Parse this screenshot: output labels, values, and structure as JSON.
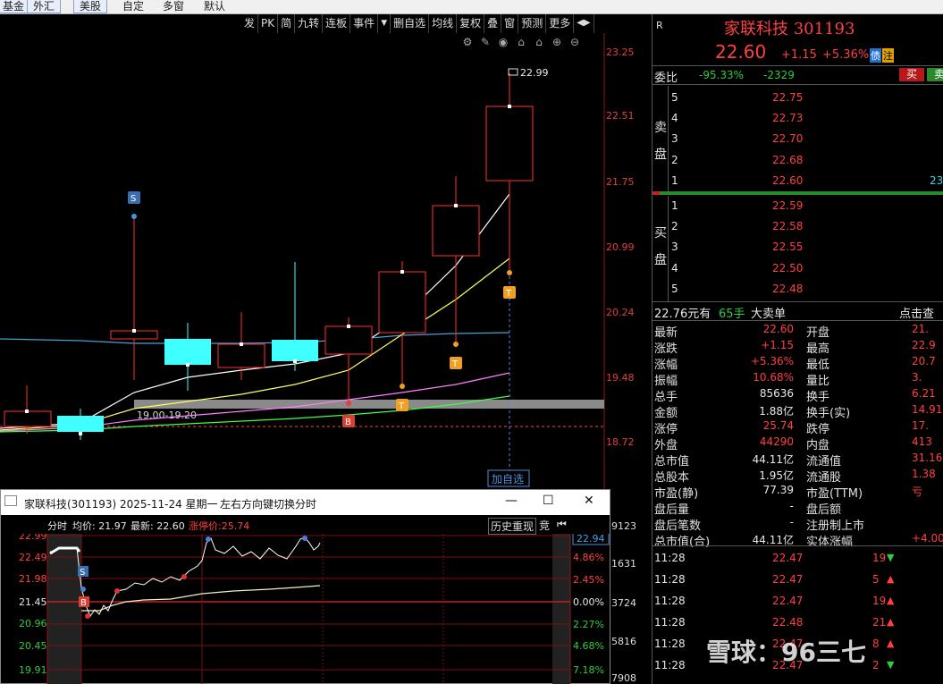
{
  "topbar": {
    "tabs": [
      "基金",
      "外汇",
      "美股",
      "自定",
      "多窗",
      "默认"
    ]
  },
  "chart_toolbar": {
    "items": [
      "发",
      "PK",
      "简",
      "九转",
      "连板",
      "事件",
      "▼",
      "删自选",
      "均线",
      "复权",
      "叠",
      "窗",
      "预测",
      "更多",
      "◀▶"
    ]
  },
  "chart_icons": [
    "⚙",
    "✎",
    "◉",
    "⌂",
    "⌂",
    "⊕",
    "⊖"
  ],
  "main_chart": {
    "price_labels": [
      "23.25",
      "22.51",
      "21.75",
      "20.99",
      "20.24",
      "19.48",
      "18.72"
    ],
    "high_marker": "22.99",
    "zone_label": "19.00-19.20",
    "add_watch_label": "加自选",
    "signals": {
      "s": "S",
      "b": "B",
      "t": "T"
    },
    "colors": {
      "up": "#ff3030",
      "down": "#40ffff",
      "ma_white": "#ffffff",
      "ma_yellow": "#ffff40",
      "ma_pink": "#ff80ff",
      "ma_green": "#40ff40",
      "ma_blue": "#4aa0d0"
    }
  },
  "quote": {
    "name": "家联科技 301193",
    "price": "22.60",
    "change": "+1.15",
    "pct": "+5.36%",
    "badges": [
      "债",
      "注"
    ],
    "r_tag": "R",
    "weibi_label": "委比",
    "weibi_pct": "-95.33%",
    "weibi_diff": "-2329",
    "buy_btn": "买",
    "sell_btn": "卖",
    "sell_side_label": "卖盘",
    "buy_side_label": "买盘",
    "asks": [
      {
        "n": "5",
        "p": "22.75"
      },
      {
        "n": "4",
        "p": "22.73"
      },
      {
        "n": "3",
        "p": "22.70"
      },
      {
        "n": "2",
        "p": "22.68"
      },
      {
        "n": "1",
        "p": "22.60",
        "v": "23"
      }
    ],
    "bids": [
      {
        "n": "1",
        "p": "22.59"
      },
      {
        "n": "2",
        "p": "22.58"
      },
      {
        "n": "3",
        "p": "22.55"
      },
      {
        "n": "4",
        "p": "22.50"
      },
      {
        "n": "5",
        "p": "22.48"
      }
    ],
    "bigorder": {
      "price": "22.76元有",
      "qty": "65手",
      "label": "大卖单",
      "link": "点击查"
    }
  },
  "stats": [
    {
      "l1": "最新",
      "v1": "22.60",
      "c1": "red",
      "l2": "开盘",
      "v2": "21."
    },
    {
      "l1": "涨跌",
      "v1": "+1.15",
      "c1": "red",
      "l2": "最高",
      "v2": "22.9"
    },
    {
      "l1": "涨幅",
      "v1": "+5.36%",
      "c1": "red",
      "l2": "最低",
      "v2": "20.7"
    },
    {
      "l1": "振幅",
      "v1": "10.68%",
      "c1": "red",
      "l2": "量比",
      "v2": "3."
    },
    {
      "l1": "总手",
      "v1": "85636",
      "c1": "white",
      "l2": "换手",
      "v2": "6.21"
    },
    {
      "l1": "金额",
      "v1": "1.88亿",
      "c1": "white",
      "l2": "换手(实)",
      "v2": "14.91"
    },
    {
      "l1": "涨停",
      "v1": "25.74",
      "c1": "red",
      "l2": "跌停",
      "v2": "17."
    },
    {
      "l1": "外盘",
      "v1": "44290",
      "c1": "red",
      "l2": "内盘",
      "v2": "413"
    },
    {
      "l1": "总市值",
      "v1": "44.11亿",
      "c1": "white",
      "l2": "流通值",
      "v2": "31.16"
    },
    {
      "l1": "总股本",
      "v1": "1.95亿",
      "c1": "white",
      "l2": "流通股",
      "v2": "1.38"
    },
    {
      "l1": "市盈(静)",
      "v1": "77.39",
      "c1": "white",
      "l2": "市盈(TTM)",
      "v2": "亏"
    },
    {
      "l1": "盘后量",
      "v1": "-",
      "c1": "white",
      "l2": "盘后额",
      "v2": ""
    },
    {
      "l1": "盘后笔数",
      "v1": "-",
      "c1": "white",
      "l2": "注册制上市",
      "v2": ""
    },
    {
      "l1": "总市值(合)",
      "v1": "44.11亿",
      "c1": "white",
      "l2": "实体涨幅",
      "v2": "+4.00"
    }
  ],
  "ticks": [
    {
      "t": "11:28",
      "p": "22.47",
      "v": "19",
      "dir": "down"
    },
    {
      "t": "11:28",
      "p": "22.47",
      "v": "5",
      "dir": "up"
    },
    {
      "t": "11:28",
      "p": "22.47",
      "v": "19",
      "dir": "up"
    },
    {
      "t": "11:28",
      "p": "22.48",
      "v": "21",
      "dir": "up"
    },
    {
      "t": "11:28",
      "p": "22.47",
      "v": "8",
      "dir": "up"
    },
    {
      "t": "11:28",
      "p": "22.47",
      "v": "2",
      "dir": "down"
    }
  ],
  "watermark": "雪球：96三七",
  "popup": {
    "title": "家联科技(301193) 2025-11-24 星期一",
    "hint": "左右方向键切换分时",
    "min_btn": "—",
    "max_btn": "☐",
    "close_btn": "✕",
    "bar_label": "分时",
    "avg_label": "均价: 21.97",
    "last_label": "最新: 22.60",
    "limit_label": "涨停价:25.74",
    "replay": "历史重现",
    "bid": "竞",
    "left_axis": [
      "22.99",
      "22.49",
      "21.98",
      "21.45",
      "20.96",
      "20.45",
      "19.91"
    ],
    "right_axis": [
      "4.86%",
      "2.45%",
      "0.00%",
      "2.27%",
      "4.68%",
      "7.18%"
    ],
    "price_tag": "22.94",
    "vol_axis": [
      "9123",
      "1631",
      "3724",
      "5816",
      "7908"
    ]
  }
}
